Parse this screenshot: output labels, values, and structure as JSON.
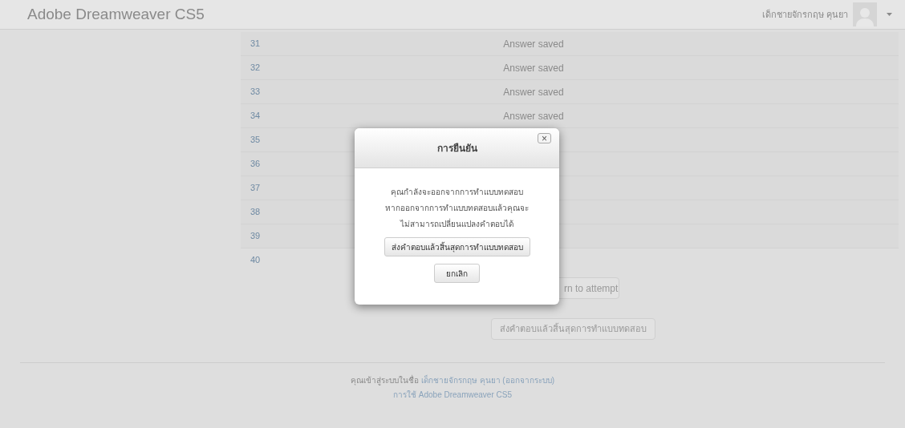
{
  "header": {
    "brand": "Adobe Dreamweaver CS5",
    "user_name": "เด็กชายจักรกฤษ คุนยา"
  },
  "table": {
    "rows": [
      {
        "number": "31",
        "status": "Answer saved"
      },
      {
        "number": "32",
        "status": "Answer saved"
      },
      {
        "number": "33",
        "status": "Answer saved"
      },
      {
        "number": "34",
        "status": "Answer saved"
      },
      {
        "number": "35"
      },
      {
        "number": "36"
      },
      {
        "number": "37"
      },
      {
        "number": "38"
      },
      {
        "number": "39"
      },
      {
        "number": "40"
      }
    ]
  },
  "page_buttons": [
    "rn to attempt",
    "ส่งคำตอบแล้วสิ้นสุดการทำแบบทดสอบ"
  ],
  "footer": {
    "logged_in_as": "คุณเข้าสู่ระบบในชื่อ",
    "user_link": "เด็กชายจักรกฤษ คุนยา",
    "logout_link": "(ออกจากระบบ)",
    "course_link": "การใช้ Adobe Dreamweaver CS5"
  },
  "dialog": {
    "title": "การยืนยัน",
    "close": "×",
    "message_lines": [
      "คุณกำลังจะออกจากการทำแบบทดสอบ",
      "หากออกจากการทำแบบทดสอบแล้วคุณจะ",
      "ไม่สามารถเปลี่ยนแปลงคำตอบได้"
    ],
    "buttons": [
      "ส่งคำตอบแล้วสิ้นสุดการทำแบบทดสอบ",
      "ยกเลิก"
    ]
  }
}
